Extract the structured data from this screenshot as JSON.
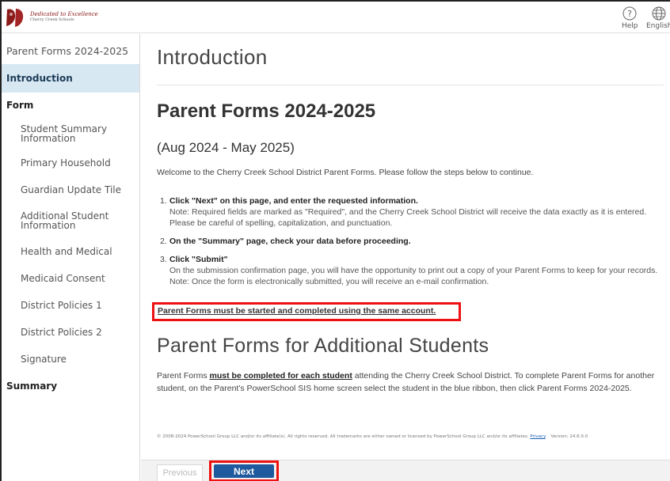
{
  "header": {
    "logo": {
      "line1": "Dedicated to Excellence",
      "line2": "Cherry Creek Schools"
    },
    "help_label": "Help",
    "language_label": "English"
  },
  "sidebar": {
    "title": "Parent Forms 2024-2025",
    "items": [
      {
        "label": "Introduction",
        "kind": "section",
        "active": true
      },
      {
        "label": "Form",
        "kind": "section",
        "active": false
      },
      {
        "label": "Student Summary Information",
        "kind": "sub"
      },
      {
        "label": "Primary Household",
        "kind": "sub"
      },
      {
        "label": "Guardian Update Tile",
        "kind": "sub"
      },
      {
        "label": "Additional Student Information",
        "kind": "sub"
      },
      {
        "label": "Health and Medical",
        "kind": "sub"
      },
      {
        "label": "Medicaid Consent",
        "kind": "sub"
      },
      {
        "label": "District Policies 1",
        "kind": "sub"
      },
      {
        "label": "District Policies 2",
        "kind": "sub"
      },
      {
        "label": "Signature",
        "kind": "sub"
      },
      {
        "label": "Summary",
        "kind": "section",
        "active": false
      }
    ]
  },
  "main": {
    "page_heading": "Introduction",
    "form_title": "Parent Forms 2024-2025",
    "date_range": "(Aug 2024 - May 2025)",
    "welcome": "Welcome to the Cherry Creek School District Parent Forms. Please follow the steps below to continue.",
    "steps": [
      {
        "number": "1.",
        "title": "Click \"Next\" on this page, and enter the requested information.",
        "note": "Note: Required fields are marked as \"Required\", and the Cherry Creek School District will receive the data exactly as it is entered. Please be careful of spelling, capitalization, and punctuation."
      },
      {
        "number": "2.",
        "title": "On the \"Summary\" page, check your data before proceeding.",
        "note": ""
      },
      {
        "number": "3.",
        "title": "Click \"Submit\"",
        "note": "On the submission confirmation page, you will have the opportunity to print out a copy of your Parent Forms to keep for your records. Note: Once the form is electronically submitted, you will receive an e-mail confirmation."
      }
    ],
    "same_account_notice": "Parent Forms must be started and completed using the same account.",
    "additional_heading": "Parent Forms for Additional Students",
    "additional_body_prefix": "Parent Forms ",
    "additional_body_emphasis": "must be completed for each student",
    "additional_body_suffix": " attending the Cherry Creek School District. To complete Parent Forms for another student, on the Parent's PowerSchool SIS home screen select the student in the blue ribbon, then click Parent Forms 2024-2025.",
    "footer_text": "© 2008-2024 PowerSchool Group LLC and/or its affiliate(s). All rights reserved. All trademarks are either owned or licensed by PowerSchool Group LLC and/or its affiliates.",
    "footer_link": "Privacy",
    "footer_version": "Version: 24.6.0.0"
  },
  "nav": {
    "previous_label": "Previous",
    "next_label": "Next"
  },
  "colors": {
    "accent_blue": "#1f5a9e",
    "active_nav_bg": "#d8e8f3",
    "highlight_red": "#e11111",
    "logo_red": "#8b1a1a"
  },
  "icons": {
    "help": "help-icon",
    "language": "globe-icon"
  }
}
